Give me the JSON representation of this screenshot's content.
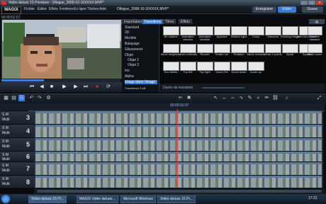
{
  "window": {
    "title": "Vidéo deluxe 15 Premium - Ollogue_2008-10-10XXXX.MVP*"
  },
  "menu": {
    "items": [
      "Fichier",
      "Éditer",
      "Effets",
      "Fenêtres",
      "En ligne",
      "Tâches",
      "Aide"
    ]
  },
  "project": {
    "title": "Ollogue_2008-10-10XXXX.MVP*"
  },
  "modes": {
    "record": "Enregistrer",
    "edit": "Éditer",
    "burn": "Graver"
  },
  "preview": {
    "timecode": "00:00:52:07"
  },
  "media": {
    "tabs": [
      "Importation",
      "Transitions",
      "Titres",
      "Effets"
    ],
    "tree": [
      "Standard",
      "3D",
      "Modèle",
      "Balayage",
      "Glissement",
      "Objet",
      "Objet 1",
      "Objet 2",
      "Iris",
      "Alpha",
      "Image dans l'image",
      "TransMove 3 AB"
    ],
    "transitions": [
      "3D rotation",
      "Animated window",
      "Animated windmill",
      "Appears",
      "Bottom right",
      "Cross",
      "Diamond",
      "Growing image",
      "Into the picture",
      "Into the distance",
      "Move lengthw...",
      "Move vertically",
      "Rhomb",
      "Rotate out",
      "Rotation",
      "Same crosses",
      "Show 4 points",
      "Spiral",
      "Square",
      "Static zoom",
      "Sun blinds",
      "Top left",
      "Top right",
      "Zoom 0%",
      "Zoom down",
      "Zoom up"
    ],
    "duration_label": "Durée de transition"
  },
  "timeline": {
    "ruler_tc": "00:00:52:07",
    "tracks": [
      {
        "num": "3",
        "label": "S M",
        "sub": "Multi"
      },
      {
        "num": "4",
        "label": "S M",
        "sub": "Multi"
      },
      {
        "num": "5",
        "label": "S M",
        "sub": "Multi"
      },
      {
        "num": "6",
        "label": "S M",
        "sub": "Multi"
      },
      {
        "num": "7",
        "label": "S M",
        "sub": "Multi"
      },
      {
        "num": "8",
        "label": "S M",
        "sub": "Multi"
      }
    ]
  },
  "taskbar": {
    "items": [
      "Vidéo deluxe 15 Pr...",
      "MAGIX Vidéo deluxe...",
      "Microsoft Windows",
      "Vidéo deluxe 15 Pr..."
    ],
    "clock": "17:21"
  },
  "colors": {
    "accent": "#3a7bd5",
    "playhead": "#e0453a",
    "record": "#d9362c"
  }
}
